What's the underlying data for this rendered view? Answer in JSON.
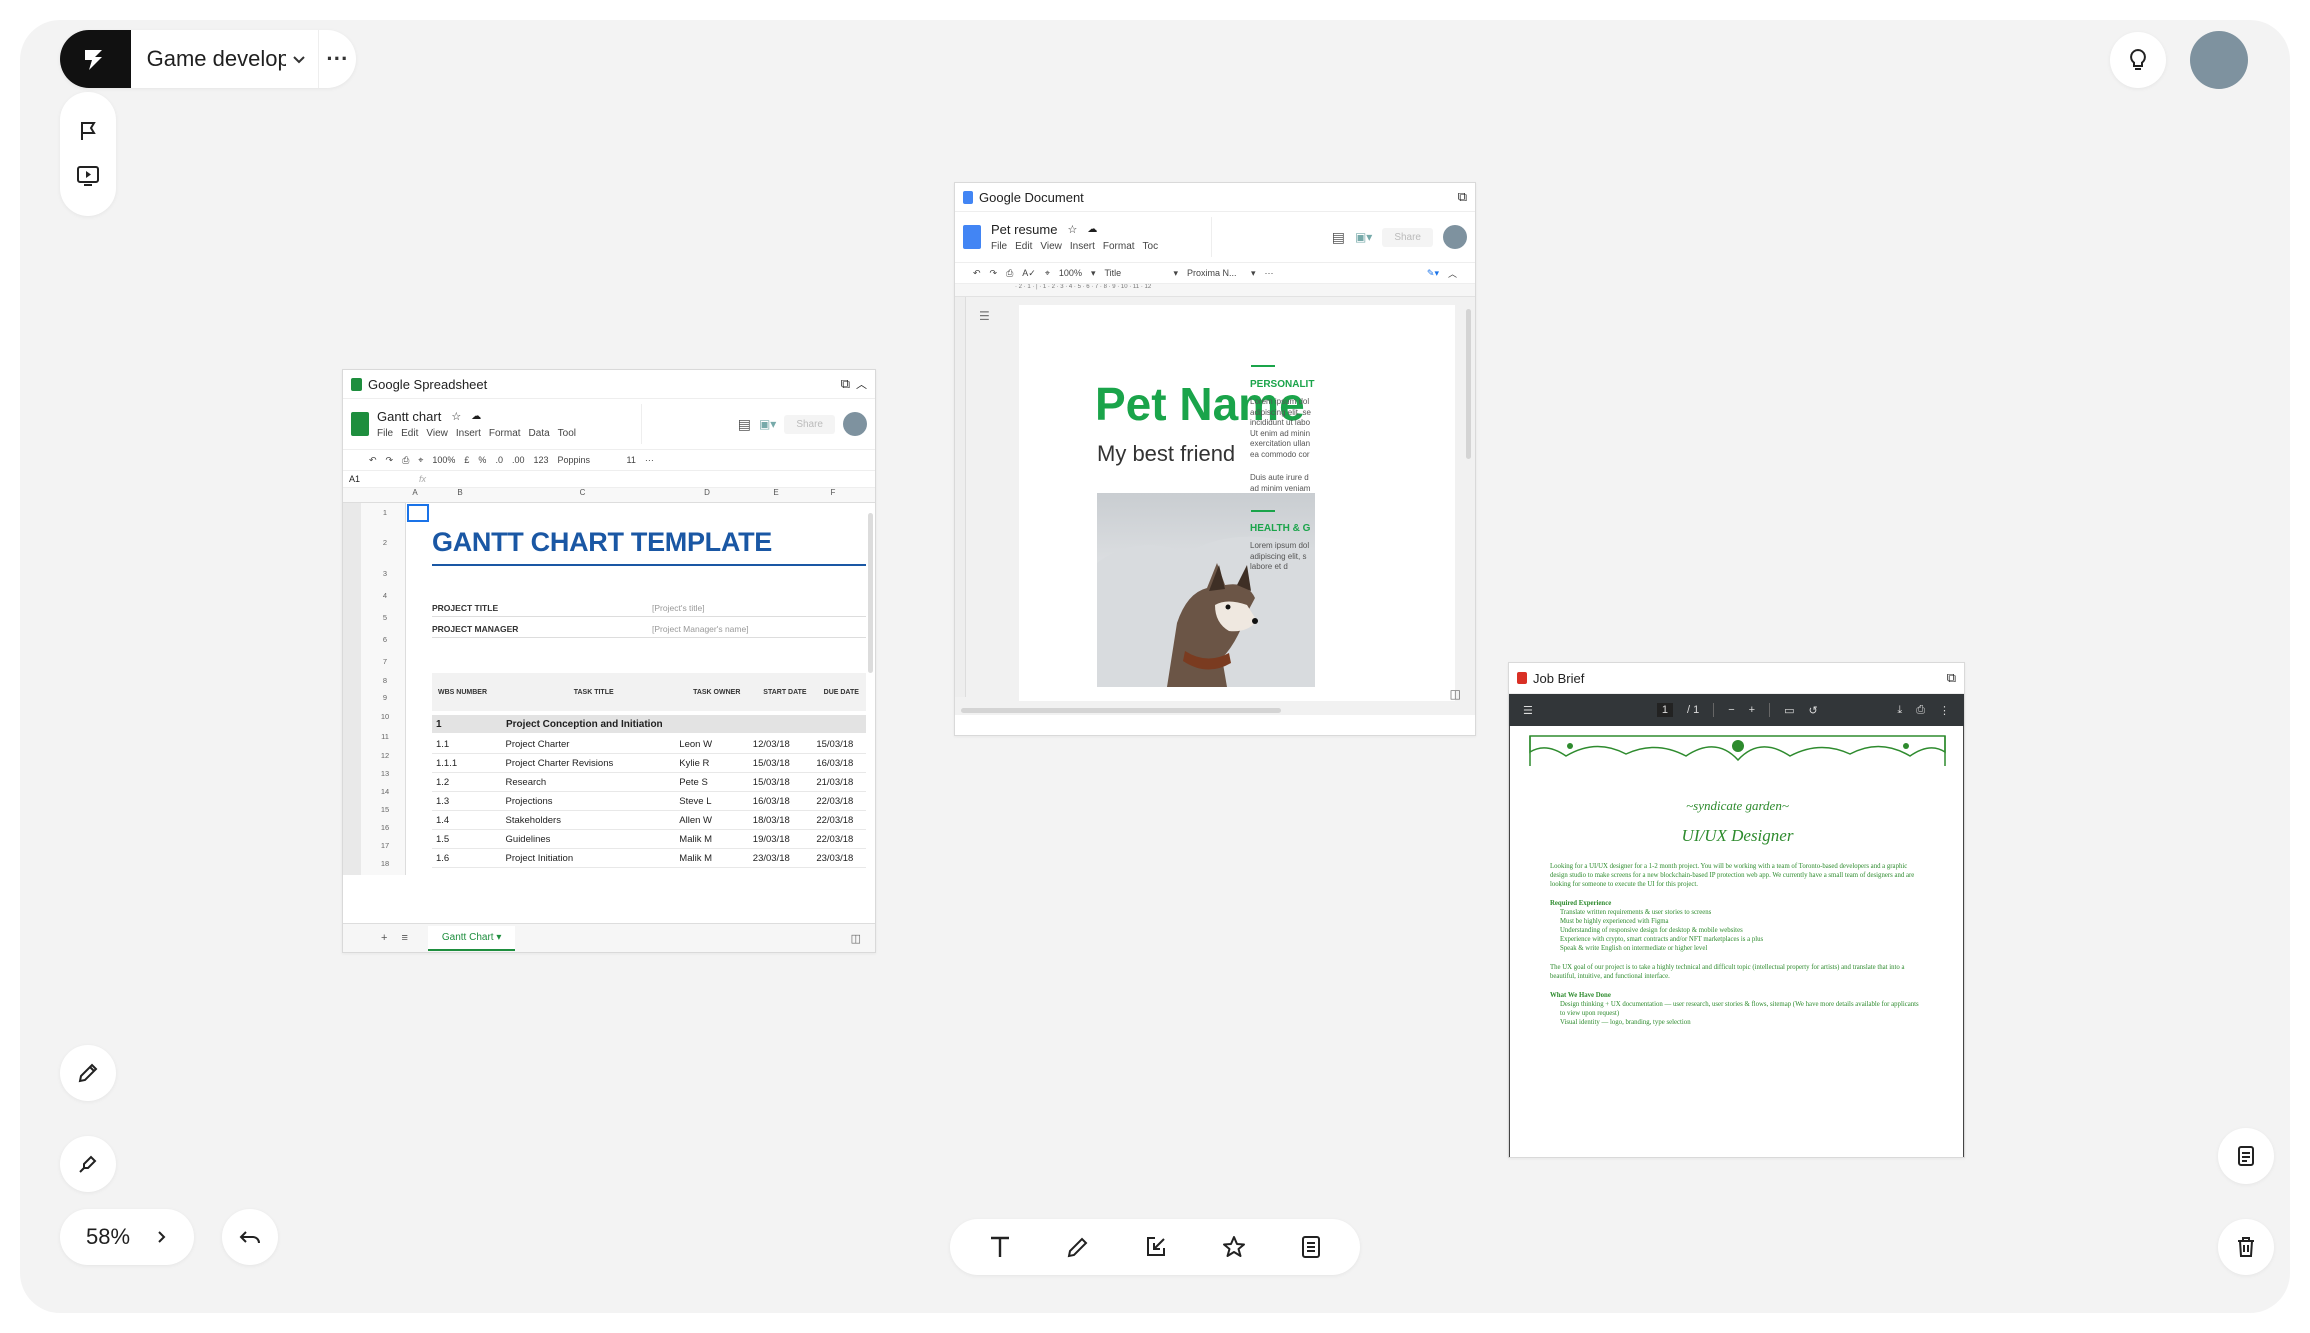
{
  "topbar": {
    "project_name": "Game developm...",
    "more_label": "···"
  },
  "zoom": {
    "level": "58%"
  },
  "spreadsheet": {
    "window_title": "Google Spreadsheet",
    "doc_name": "Gantt chart",
    "menu": [
      "File",
      "Edit",
      "View",
      "Insert",
      "Format",
      "Data",
      "Tool"
    ],
    "share_label": "Share",
    "toolbar": {
      "zoom": "100%",
      "currency": "£",
      "percent": "%",
      "dec1": ".0",
      "dec2": ".00",
      "fmt": "123",
      "font": "Poppins",
      "size": "11"
    },
    "cell_ref": "A1",
    "fx": "fx",
    "columns": [
      "A",
      "B",
      "C",
      "D",
      "E",
      "F"
    ],
    "row_numbers": [
      "1",
      "2",
      "3",
      "4",
      "5",
      "6",
      "7",
      "8",
      "9",
      "10",
      "11",
      "12",
      "13",
      "14",
      "15",
      "16",
      "17",
      "18"
    ],
    "title": "GANTT CHART TEMPLATE",
    "project_title_label": "PROJECT TITLE",
    "project_title_value": "[Project's title]",
    "project_manager_label": "PROJECT MANAGER",
    "project_manager_value": "[Project Manager's name]",
    "headers": [
      "WBS NUMBER",
      "TASK TITLE",
      "TASK OWNER",
      "START DATE",
      "DUE DATE"
    ],
    "phase_number": "1",
    "phase_title": "Project Conception and Initiation",
    "rows": [
      {
        "wbs": "1.1",
        "task": "Project Charter",
        "owner": "Leon W",
        "start": "12/03/18",
        "due": "15/03/18"
      },
      {
        "wbs": "1.1.1",
        "task": "Project Charter Revisions",
        "owner": "Kylie R",
        "start": "15/03/18",
        "due": "16/03/18"
      },
      {
        "wbs": "1.2",
        "task": "Research",
        "owner": "Pete S",
        "start": "15/03/18",
        "due": "21/03/18"
      },
      {
        "wbs": "1.3",
        "task": "Projections",
        "owner": "Steve L",
        "start": "16/03/18",
        "due": "22/03/18"
      },
      {
        "wbs": "1.4",
        "task": "Stakeholders",
        "owner": "Allen W",
        "start": "18/03/18",
        "due": "22/03/18"
      },
      {
        "wbs": "1.5",
        "task": "Guidelines",
        "owner": "Malik M",
        "start": "19/03/18",
        "due": "22/03/18"
      },
      {
        "wbs": "1.6",
        "task": "Project Initiation",
        "owner": "Malik M",
        "start": "23/03/18",
        "due": "23/03/18"
      }
    ],
    "sheet_tab": "Gantt Chart"
  },
  "document": {
    "window_title": "Google Document",
    "doc_name": "Pet resume",
    "menu": [
      "File",
      "Edit",
      "View",
      "Insert",
      "Format",
      "Toc"
    ],
    "share_label": "Share",
    "toolbar": {
      "zoom": "100%",
      "style": "Title",
      "font": "Proxima N..."
    },
    "ruler": "· 2 · 1 · | · 1 · 2 · 3 · 4 · 5 · 6 · 7 · 8 · 9 · 10 · 11 · 12",
    "pet_name": "Pet Name",
    "subtitle": "My best friend",
    "section1": "PERSONALIT",
    "lorem1": [
      "Lorem ipsum dol",
      "adipiscing elit, se",
      "incididunt ut labo",
      "Ut enim ad minin",
      "exercitation ullan",
      "ea commodo cor"
    ],
    "lorem2": [
      "Duis aute irure d",
      "ad minim veniam"
    ],
    "section2": "HEALTH & G",
    "lorem3": [
      "Lorem ipsum dol",
      "adipiscing elit, s",
      "labore et d"
    ],
    "accent": "#1aa44a"
  },
  "pdf": {
    "window_title": "Job Brief",
    "page_current": "1",
    "page_total": "/ 1",
    "company": "syndicate garden",
    "job_title": "UI/UX Designer",
    "intro": "Looking for a UI/UX designer for a 1-2 month project. You will be working with a team of Toronto-based developers and a graphic design studio to make screens for a new blockchain-based IP protection web app. We currently have a small team of designers and are looking for someone to execute the UI for this project.",
    "req_heading": "Required Experience",
    "req_items": [
      "Translate written requirements & user stories to screens",
      "Must be highly experienced with Figma",
      "Understanding of responsive design for desktop & mobile websites",
      "Experience with crypto, smart contracts and/or NFT marketplaces is a plus",
      "Speak & write English on intermediate or higher level"
    ],
    "goal": "The UX goal of our project is to take a highly technical and difficult topic (intellectual property for artists) and translate that into a beautiful, intuitive, and functional interface.",
    "have_heading": "What We Have Done",
    "have_items": [
      "Design thinking + UX documentation — user research, user stories & flows, sitemap (We have more details available for applicants to view upon request)",
      "Visual identity — logo, branding, type selection"
    ],
    "accent": "#2e8b2e"
  }
}
